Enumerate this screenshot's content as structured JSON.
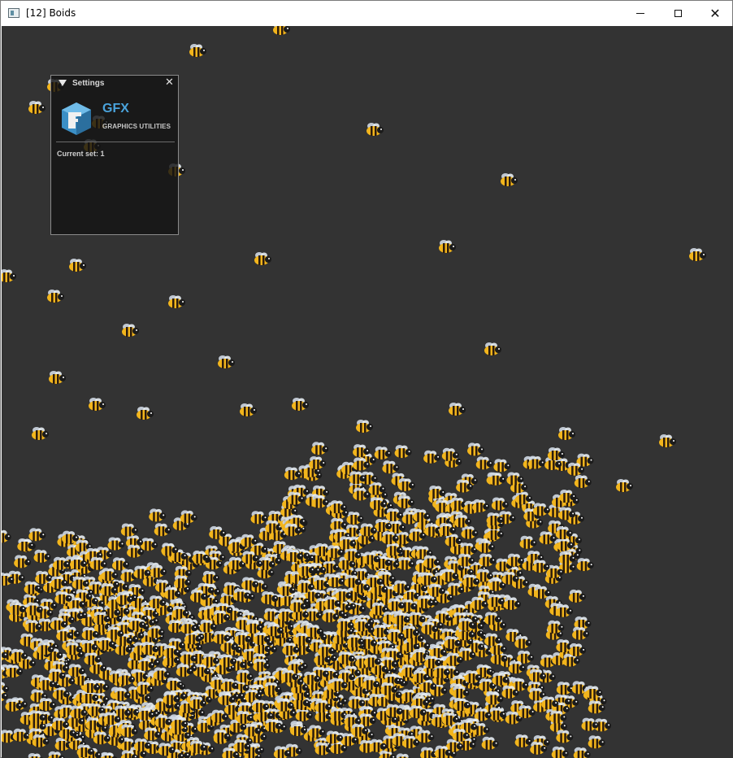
{
  "window": {
    "title": "[12] Boids"
  },
  "caption": {
    "minimize": "",
    "maximize": "",
    "close": "✕"
  },
  "panel": {
    "title": "Settings",
    "close": "✕",
    "brand": {
      "name": "GFX",
      "subtitle": "GRAPHICS UTILITIES"
    },
    "status": "Current set: 1"
  },
  "scene": {
    "background": "#333333",
    "agent_icon": "bee-icon",
    "colors": {
      "body": "#f2b51c",
      "stripe": "#2a1b0e",
      "wing": "#cfd8e3",
      "head": "#1b1b1b"
    }
  }
}
